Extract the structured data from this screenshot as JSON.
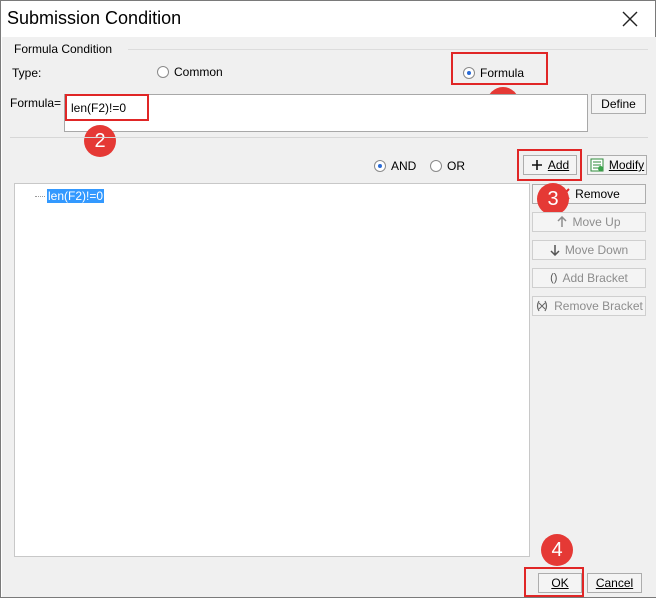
{
  "window": {
    "title": "Submission Condition"
  },
  "formula_condition": {
    "group_label": "Formula Condition",
    "type_label": "Type:",
    "options": [
      {
        "label": "Common",
        "selected": false
      },
      {
        "label": "Formula",
        "selected": true
      }
    ],
    "formula_label": "Formula=",
    "formula_value": "len(F2)!=0",
    "define_button": "Define"
  },
  "logic": {
    "and_label": "AND",
    "or_label": "OR",
    "selected": "AND"
  },
  "actions": {
    "add": "Add",
    "modify": "Modify",
    "remove": "Remove",
    "move_up": "Move Up",
    "move_down": "Move Down",
    "add_bracket": "Add Bracket",
    "remove_bracket": "Remove Bracket"
  },
  "conditions": [
    "len(F2)!=0"
  ],
  "footer": {
    "ok": "OK",
    "cancel": "Cancel"
  },
  "annotations": [
    "1",
    "2",
    "3",
    "4"
  ],
  "colors": {
    "annotation_red": "#e53935",
    "selection_blue": "#3399ff",
    "radio_dot": "#2a6bd6"
  }
}
